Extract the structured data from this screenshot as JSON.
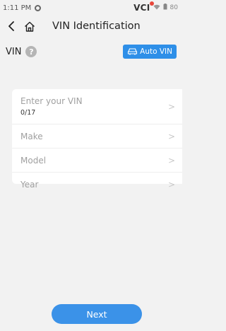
{
  "status_bar": {
    "time": "1:11 PM",
    "vci": "VCI",
    "battery": "80"
  },
  "header": {
    "title": "VIN Identification",
    "back_icon": "back-arrow",
    "home_icon": "home"
  },
  "vin_section": {
    "label": "VIN",
    "help_icon": "?",
    "auto_vin_label": "Auto VIN"
  },
  "fields": {
    "vin": {
      "placeholder": "Enter your VIN",
      "count": "0/17"
    },
    "make": {
      "label": "Make"
    },
    "model": {
      "label": "Model"
    },
    "year": {
      "label": "Year"
    }
  },
  "footer": {
    "next_label": "Next"
  },
  "colors": {
    "accent": "#2e8fe8",
    "vci_badge": "#e8463b",
    "background": "#f2f2f2"
  }
}
